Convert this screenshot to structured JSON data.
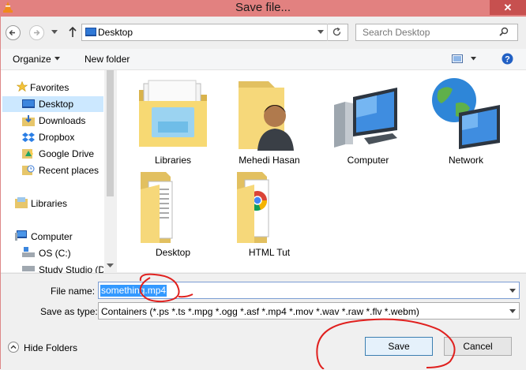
{
  "window": {
    "title": "Save file...",
    "close_glyph": "✕"
  },
  "address": {
    "path": "Desktop",
    "search_placeholder": "Search Desktop"
  },
  "toolbar": {
    "organize": "Organize",
    "new_folder": "New folder"
  },
  "sidebar": {
    "favorites": "Favorites",
    "favorites_items": [
      "Desktop",
      "Downloads",
      "Dropbox",
      "Google Drive",
      "Recent places"
    ],
    "libraries": "Libraries",
    "computer": "Computer",
    "computer_items": [
      "OS (C:)",
      "Study Studio (D"
    ]
  },
  "items": [
    "Libraries",
    "Mehedi Hasan",
    "Computer",
    "Network",
    "Desktop",
    "HTML Tut"
  ],
  "form": {
    "file_name_label": "File name:",
    "file_name_value": "something.mp4",
    "save_type_label": "Save as type:",
    "save_type_value": "Containers (*.ps *.ts *.mpg *.ogg *.asf *.mp4 *.mov *.wav *.raw *.flv *.webm)"
  },
  "footer": {
    "hide_folders": "Hide Folders",
    "save": "Save",
    "cancel": "Cancel"
  },
  "colors": {
    "titlebar": "#e28180",
    "close": "#c7504f",
    "selection": "#3399ff",
    "annotation": "#e0201e"
  }
}
